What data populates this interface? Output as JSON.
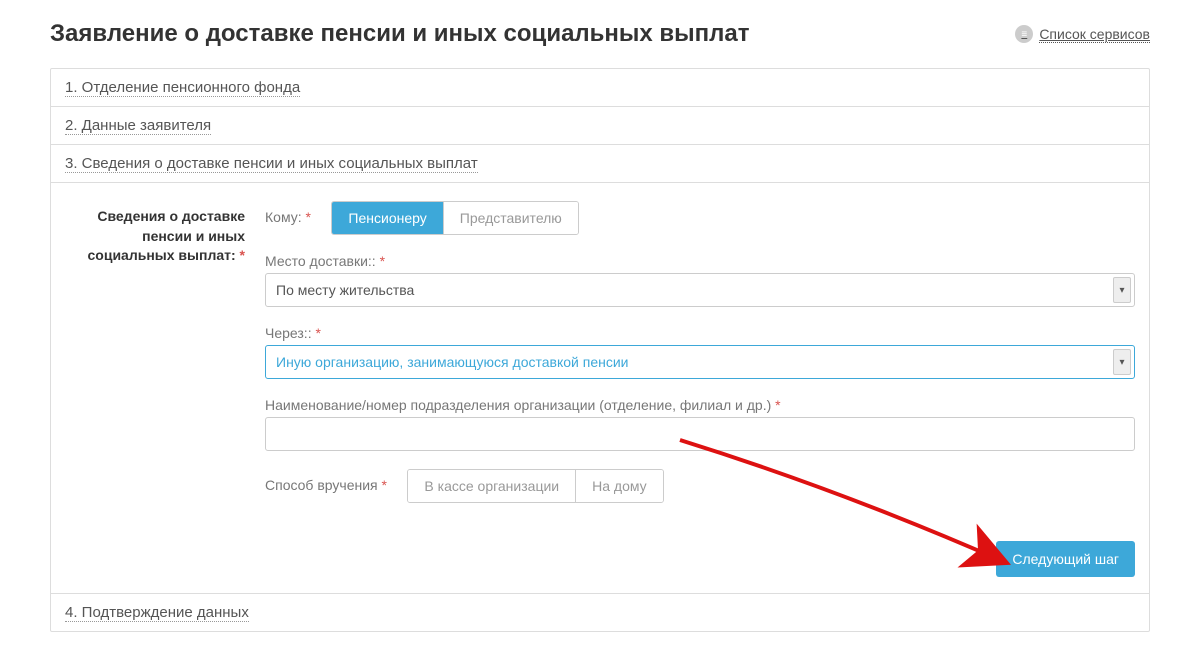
{
  "header": {
    "title": "Заявление о доставке пенсии и иных социальных выплат",
    "services_link": "Список сервисов"
  },
  "steps": {
    "s1": "1. Отделение пенсионного фонда",
    "s2": "2. Данные заявителя",
    "s3": "3. Сведения о доставке пенсии и иных социальных выплат",
    "s4": "4. Подтверждение данных"
  },
  "form": {
    "side_label": "Сведения о доставке пенсии и иных социальных выплат:",
    "to_label": "Кому:",
    "to_options": {
      "opt1": "Пенсионеру",
      "opt2": "Представителю"
    },
    "place_label": "Место доставки::",
    "place_value": "По месту жительства",
    "via_label": "Через::",
    "via_value": "Иную организацию, занимающуюся доставкой пенсии",
    "org_label": "Наименование/номер подразделения организации (отделение, филиал и др.)",
    "org_value": "",
    "method_label": "Способ вручения",
    "method_options": {
      "opt1": "В кассе организации",
      "opt2": "На дому"
    },
    "next_button": "Следующий шаг"
  },
  "colors": {
    "accent": "#3da8d9",
    "required": "#d9534f"
  }
}
